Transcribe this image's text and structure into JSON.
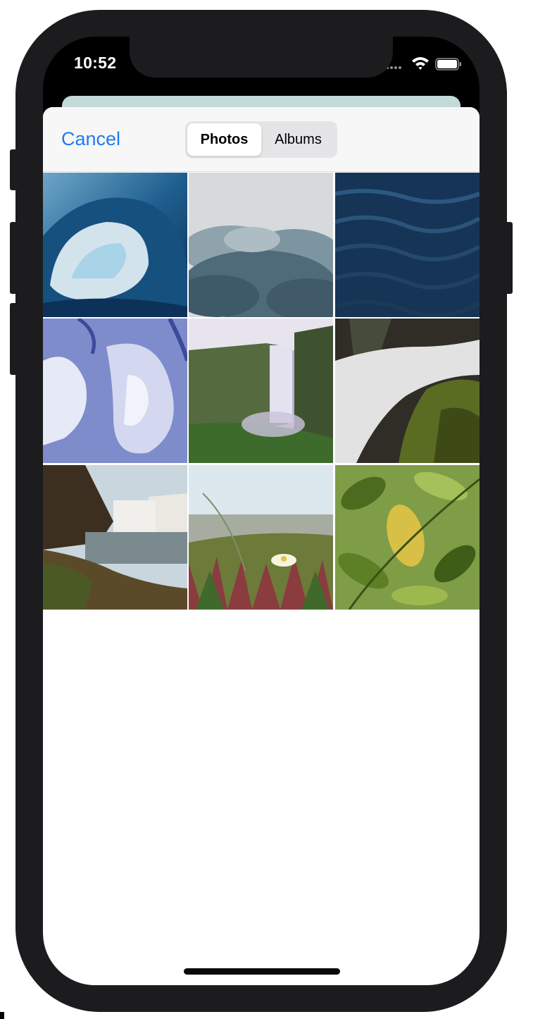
{
  "status_bar": {
    "time": "10:52",
    "icons": [
      "cellular-dots-icon",
      "wifi-icon",
      "battery-icon"
    ]
  },
  "picker": {
    "cancel_label": "Cancel",
    "tabs": [
      {
        "label": "Photos",
        "selected": true
      },
      {
        "label": "Albums",
        "selected": false
      }
    ]
  },
  "photos": [
    {
      "name": "ocean-wave-photo"
    },
    {
      "name": "clouds-photo"
    },
    {
      "name": "dark-water-photo"
    },
    {
      "name": "blue-ice-photo"
    },
    {
      "name": "waterfall-cliff-photo"
    },
    {
      "name": "waterfall-rocks-photo"
    },
    {
      "name": "waterfall-lake-photo"
    },
    {
      "name": "flower-grass-photo"
    },
    {
      "name": "green-leaves-photo"
    }
  ],
  "colors": {
    "accent": "#1f7cf0",
    "header_bg": "#f7f7f8",
    "segment_bg": "#e5e5e8",
    "device_frame": "#1c1c1e"
  }
}
